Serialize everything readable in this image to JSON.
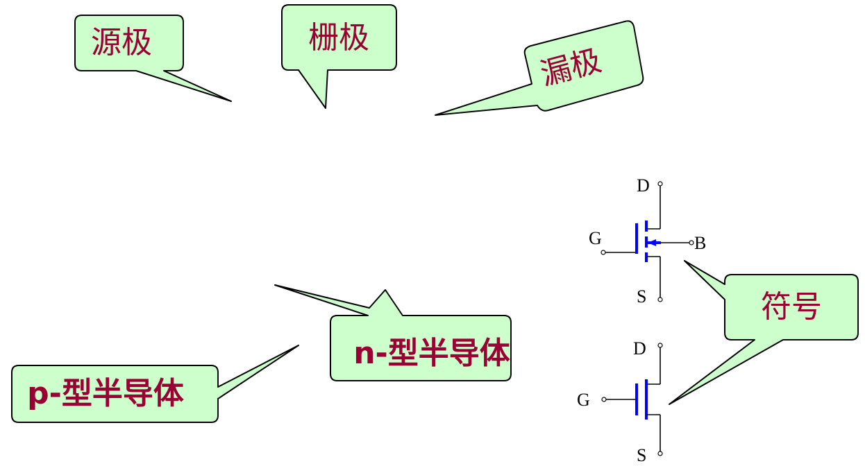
{
  "callouts": {
    "source": "源极",
    "gate": "栅极",
    "drain": "漏极",
    "n_type": "n-型半导体",
    "p_type": "p-型半导体",
    "symbol": "符号"
  },
  "symbol_top": {
    "drain": "D",
    "gate": "G",
    "body": "B",
    "source": "S"
  },
  "symbol_bottom": {
    "drain": "D",
    "gate": "G",
    "source": "S"
  },
  "colors": {
    "callout_fill": "#ccffcc",
    "callout_text": "#990033",
    "symbol_accent": "#0000ff"
  }
}
